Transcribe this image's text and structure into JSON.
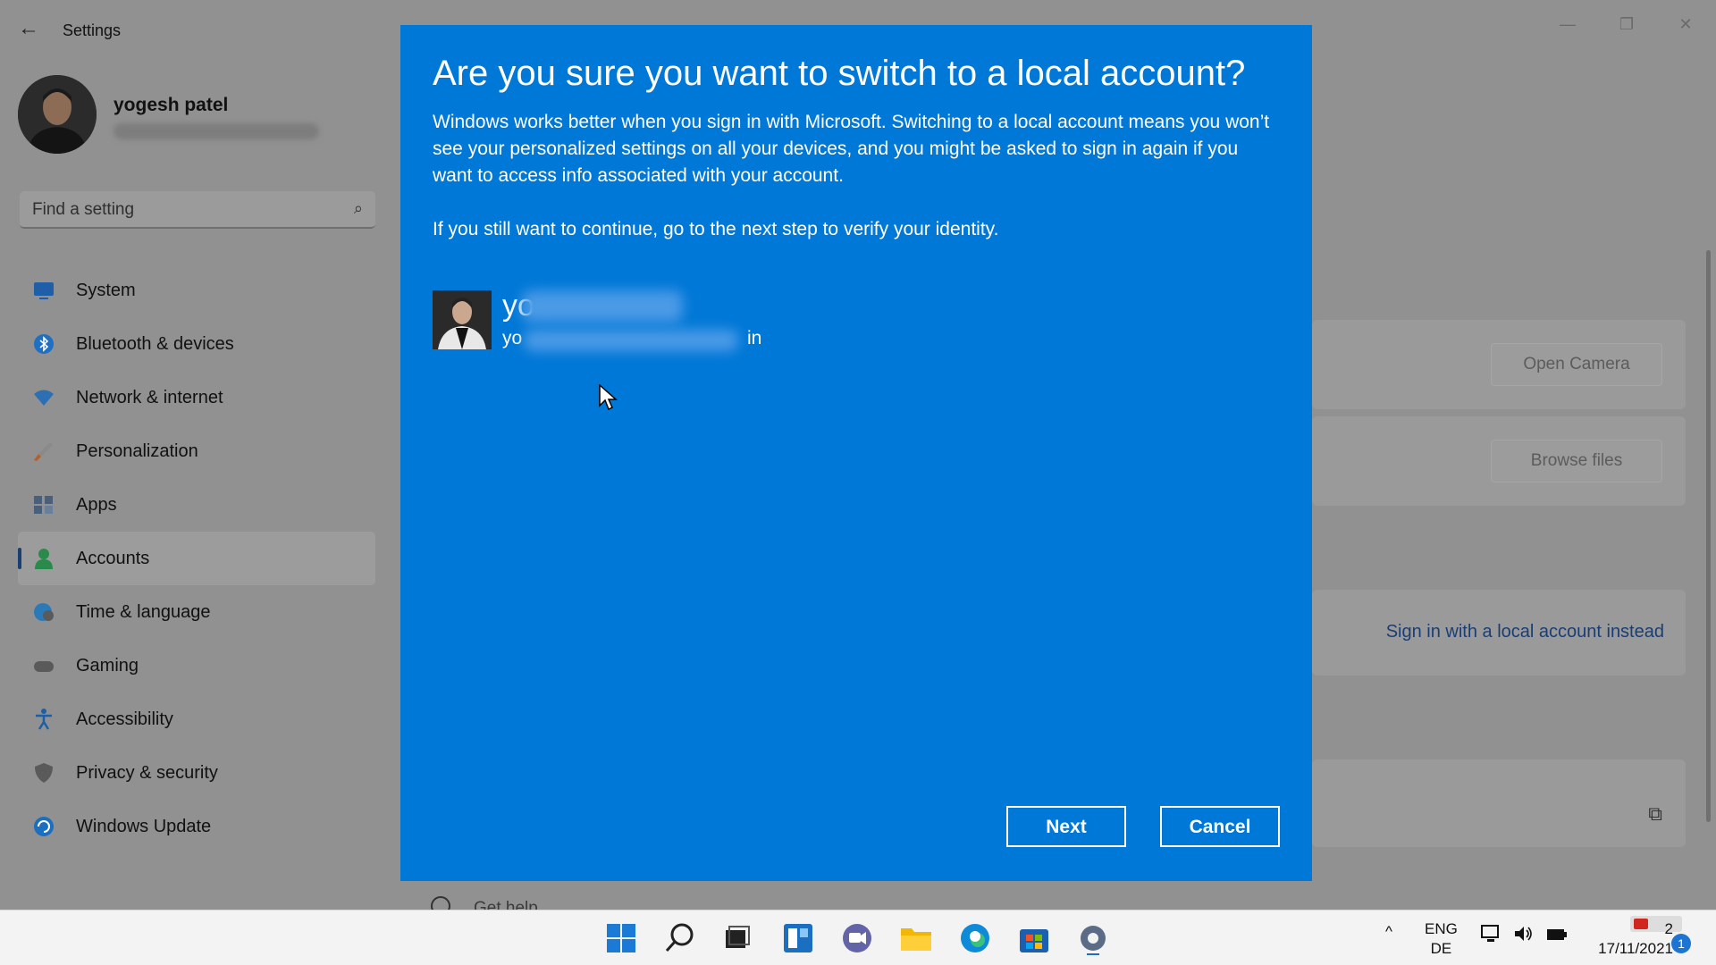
{
  "window": {
    "title": "Settings",
    "back_glyph": "←",
    "minimize_glyph": "—",
    "maximize_glyph": "❐",
    "close_glyph": "✕"
  },
  "profile": {
    "name": "yogesh patel"
  },
  "search": {
    "placeholder": "Find a setting",
    "icon": "⌕"
  },
  "sidebar": {
    "items": [
      {
        "label": "System",
        "icon": "system-icon",
        "color": "#1f5fa8"
      },
      {
        "label": "Bluetooth & devices",
        "icon": "bluetooth-icon",
        "color": "#1f6fc2"
      },
      {
        "label": "Network & internet",
        "icon": "network-icon",
        "color": "#2d6fb3"
      },
      {
        "label": "Personalization",
        "icon": "brush-icon",
        "color": "#b5602c"
      },
      {
        "label": "Apps",
        "icon": "apps-icon",
        "color": "#4a5f7a"
      },
      {
        "label": "Accounts",
        "icon": "accounts-icon",
        "color": "#2a8a4c",
        "selected": true
      },
      {
        "label": "Time & language",
        "icon": "globe-clock-icon",
        "color": "#2a7ab8"
      },
      {
        "label": "Gaming",
        "icon": "gamepad-icon",
        "color": "#5a5a5a"
      },
      {
        "label": "Accessibility",
        "icon": "accessibility-icon",
        "color": "#1a5fa8"
      },
      {
        "label": "Privacy & security",
        "icon": "shield-icon",
        "color": "#5a5a5a"
      },
      {
        "label": "Windows Update",
        "icon": "update-icon",
        "color": "#1a6fc0"
      }
    ]
  },
  "content": {
    "open_camera": "Open Camera",
    "browse_files": "Browse files",
    "local_account_link": "Sign in with a local account instead",
    "get_help": "Get help"
  },
  "dialog": {
    "title": "Are you sure you want to switch to a local account?",
    "paragraph1": "Windows works better when you sign in with Microsoft. Switching to a local account means you won’t see your personalized settings on all your devices, and you might be asked to sign in again if you want to access info associated with your account.",
    "paragraph2": "If you still want to continue, go to the next step to verify your identity.",
    "account_name_visible": "yo",
    "account_email_start": "yo",
    "account_email_end": "in",
    "next_label": "Next",
    "cancel_label": "Cancel",
    "background": "#0078d7"
  },
  "taskbar": {
    "icons": [
      "start-icon",
      "search-icon",
      "task-view-icon",
      "widgets-icon",
      "chat-icon",
      "file-explorer-icon",
      "edge-icon",
      "store-icon",
      "settings-icon"
    ],
    "lang_top": "ENG",
    "lang_bottom": "DE",
    "clock_date": "17/11/2021",
    "clock_time_partial": "2",
    "notification_count": "1",
    "chevron": "^"
  }
}
